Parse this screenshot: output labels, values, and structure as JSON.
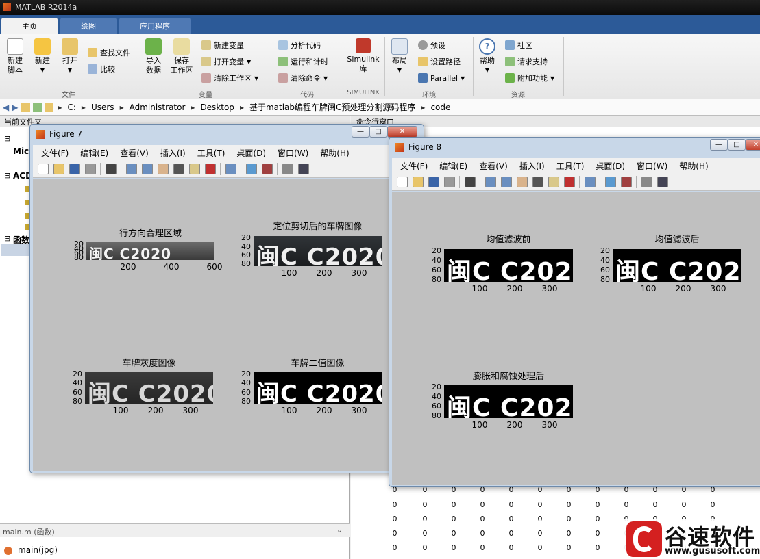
{
  "app": {
    "title": "MATLAB R2014a"
  },
  "ribbon": {
    "tabs": [
      "主页",
      "绘图",
      "应用程序"
    ],
    "home": {
      "new_script": "新建\n脚本",
      "new": "新建",
      "open": "打开",
      "find_files": "查找文件",
      "compare": "比较",
      "import_data": "导入\n数据",
      "save_workspace": "保存\n工作区",
      "new_variable": "新建变量",
      "open_variable": "打开变量",
      "clear_workspace": "清除工作区",
      "analyze_code": "分析代码",
      "run_and_time": "运行和计时",
      "clear_commands": "清除命令",
      "simulink": "Simulink\n库",
      "layout": "布局",
      "preferences": "预设",
      "set_path": "设置路径",
      "parallel": "Parallel",
      "help": "帮助",
      "community": "社区",
      "request_support": "请求支持",
      "add_ons": "附加功能"
    },
    "groups": [
      "文件",
      "变量",
      "代码",
      "SIMULINK",
      "环境",
      "资源"
    ]
  },
  "address": {
    "crumbs": [
      "C:",
      "Users",
      "Administrator",
      "Desktop",
      "基于matlab编程车牌闽C预处理分割源码程序",
      "code"
    ]
  },
  "left_panel": {
    "header": "当前文件夹",
    "tree": [
      "Mic",
      "ACD",
      "函数"
    ],
    "file_label": "main.m (函数)",
    "file_item": "main(jpg)"
  },
  "command_window": {
    "header": "命令行窗口",
    "zero": "0"
  },
  "figure_menu": [
    "文件(F)",
    "编辑(E)",
    "查看(V)",
    "插入(I)",
    "工具(T)",
    "桌面(D)",
    "窗口(W)",
    "帮助(H)"
  ],
  "figure7": {
    "title": "Figure 7",
    "plots": [
      {
        "title": "行方向合理区域",
        "xticks": [
          "200",
          "400",
          "600"
        ],
        "yticks": [
          "20",
          "40",
          "60",
          "80"
        ]
      },
      {
        "title": "定位剪切后的车牌图像",
        "xticks": [
          "100",
          "200",
          "300"
        ],
        "yticks": [
          "20",
          "40",
          "60",
          "80"
        ]
      },
      {
        "title": "车牌灰度图像",
        "xticks": [
          "100",
          "200",
          "300"
        ],
        "yticks": [
          "20",
          "40",
          "60",
          "80"
        ]
      },
      {
        "title": "车牌二值图像",
        "xticks": [
          "100",
          "200",
          "300"
        ],
        "yticks": [
          "20",
          "40",
          "60",
          "80"
        ]
      }
    ]
  },
  "figure8": {
    "title": "Figure 8",
    "plots": [
      {
        "title": "均值滤波前",
        "xticks": [
          "100",
          "200",
          "300"
        ],
        "yticks": [
          "20",
          "40",
          "60",
          "80"
        ]
      },
      {
        "title": "均值滤波后",
        "xticks": [
          "100",
          "200",
          "300"
        ],
        "yticks": [
          "20",
          "40",
          "60",
          "80"
        ]
      },
      {
        "title": "膨胀和腐蚀处理后",
        "xticks": [
          "100",
          "200",
          "300"
        ],
        "yticks": [
          "20",
          "40",
          "60",
          "80"
        ]
      }
    ]
  },
  "plate": {
    "text": "闽C C2020"
  },
  "watermark": {
    "brand": "谷速软件",
    "url": "www.gususoft.com"
  }
}
